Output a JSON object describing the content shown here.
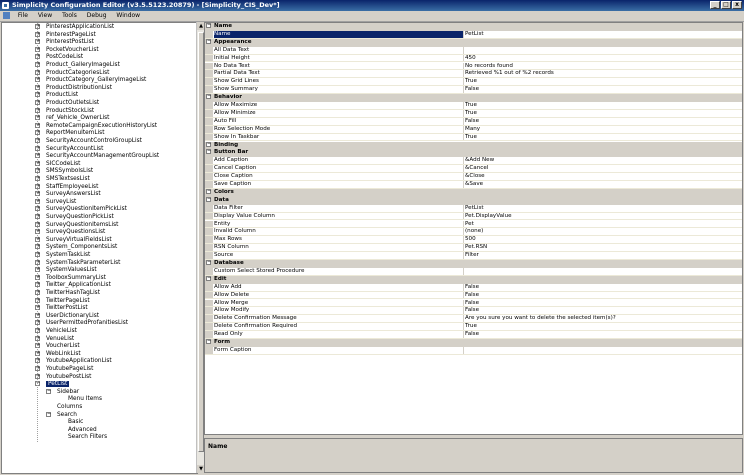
{
  "window": {
    "title": "Simplicity Configuration Editor (v3.5.5123.20879) - [Simplicity_CIS_Dev*]",
    "min": "_",
    "max": "□",
    "close": "x"
  },
  "menu": [
    "File",
    "View",
    "Tools",
    "Debug",
    "Window"
  ],
  "tree": {
    "collapsed_items": [
      "PinterestApplicationList",
      "PinterestPageList",
      "PinterestPostList",
      "PocketVoucherList",
      "PostCodeList",
      "Product_GalleryImageList",
      "ProductCategoriesList",
      "ProductCategory_GalleryImageList",
      "ProductDistributionList",
      "ProductList",
      "ProductOutletsList",
      "ProductStockList",
      "ref_Vehicle_OwnerList",
      "RemoteCampaignExecutionHistoryList",
      "ReportMenuItemList",
      "SecurityAccountControlGroupList",
      "SecurityAccountList",
      "SecurityAccountManagementGroupList",
      "SICCodeList",
      "SMSSymbolsList",
      "SMSTextsesList",
      "StaffEmployeeList",
      "SurveyAnswersList",
      "SurveyList",
      "SurveyQuestionItemPickList",
      "SurveyQuestionPickList",
      "SurveyQuestionItemsList",
      "SurveyQuestionsList",
      "SurveyVirtualFieldsList",
      "System_ComponentsList",
      "SystemTaskList",
      "SystemTaskParameterList",
      "SystemValuesList",
      "ToolboxSummaryList",
      "Twitter_ApplicationList",
      "TwitterHashTagList",
      "TwitterPageList",
      "TwitterPostList",
      "UserDictionaryList",
      "UserPermittedProfanitiesList",
      "VehicleList",
      "VenueList",
      "VoucherList",
      "WebLinkList",
      "YoutubeApplicationList",
      "YoutubePageList",
      "YoutubePostList"
    ],
    "expanded_item": "PetList",
    "children": [
      {
        "label": "Sidebar",
        "level": 1,
        "toggle": "−"
      },
      {
        "label": "Menu Items",
        "level": 2,
        "toggle": ""
      },
      {
        "label": "Columns",
        "level": 1,
        "toggle": ""
      },
      {
        "label": "Search",
        "level": 1,
        "toggle": "−"
      },
      {
        "label": "Basic",
        "level": 2,
        "toggle": ""
      },
      {
        "label": "Advanced",
        "level": 2,
        "toggle": ""
      },
      {
        "label": "Search Filters",
        "level": 2,
        "toggle": ""
      }
    ]
  },
  "properties": [
    {
      "type": "cat",
      "name": "Name"
    },
    {
      "type": "item",
      "name": "Name",
      "value": "PetList",
      "selected": true
    },
    {
      "type": "cat",
      "name": "Appearance"
    },
    {
      "type": "item",
      "name": "All Data Text",
      "value": ""
    },
    {
      "type": "item",
      "name": "Initial Height",
      "value": "450"
    },
    {
      "type": "item",
      "name": "No Data Text",
      "value": "No records found"
    },
    {
      "type": "item",
      "name": "Partial Data Text",
      "value": "Retrieved %1 out of %2 records"
    },
    {
      "type": "item",
      "name": "Show Grid Lines",
      "value": "True"
    },
    {
      "type": "item",
      "name": "Show Summary",
      "value": "False"
    },
    {
      "type": "cat",
      "name": "Behavior"
    },
    {
      "type": "item",
      "name": "Allow Maximize",
      "value": "True"
    },
    {
      "type": "item",
      "name": "Allow Minimize",
      "value": "True"
    },
    {
      "type": "item",
      "name": "Auto Fill",
      "value": "False"
    },
    {
      "type": "item",
      "name": "Row Selection Mode",
      "value": "Many"
    },
    {
      "type": "item",
      "name": "Show In Taskbar",
      "value": "True"
    },
    {
      "type": "cat",
      "name": "Binding"
    },
    {
      "type": "cat",
      "name": "Button Bar"
    },
    {
      "type": "item",
      "name": "Add Caption",
      "value": "&Add New"
    },
    {
      "type": "item",
      "name": "Cancel Caption",
      "value": "&Cancel"
    },
    {
      "type": "item",
      "name": "Close Caption",
      "value": "&Close"
    },
    {
      "type": "item",
      "name": "Save Caption",
      "value": "&Save"
    },
    {
      "type": "cat",
      "name": "Colors"
    },
    {
      "type": "cat",
      "name": "Data"
    },
    {
      "type": "item",
      "name": "Data Filter",
      "value": "PetList"
    },
    {
      "type": "item",
      "name": "Display Value Column",
      "value": "Pet.DisplayValue"
    },
    {
      "type": "item",
      "name": "Entity",
      "value": "Pet"
    },
    {
      "type": "item",
      "name": "Invalid Column",
      "value": "(none)"
    },
    {
      "type": "item",
      "name": "Max Rows",
      "value": "500"
    },
    {
      "type": "item",
      "name": "RSN Column",
      "value": "Pet.RSN"
    },
    {
      "type": "item",
      "name": "Source",
      "value": "Filter"
    },
    {
      "type": "cat",
      "name": "Database"
    },
    {
      "type": "item",
      "name": "Custom Select Stored Procedure",
      "value": ""
    },
    {
      "type": "cat",
      "name": "Edit"
    },
    {
      "type": "item",
      "name": "Allow Add",
      "value": "False"
    },
    {
      "type": "item",
      "name": "Allow Delete",
      "value": "False"
    },
    {
      "type": "item",
      "name": "Allow Merge",
      "value": "False"
    },
    {
      "type": "item",
      "name": "Allow Modify",
      "value": "False"
    },
    {
      "type": "item",
      "name": "Delete Confirmation Message",
      "value": "Are you sure you want to delete the selected item(s)?"
    },
    {
      "type": "item",
      "name": "Delete Confirmation Required",
      "value": "True"
    },
    {
      "type": "item",
      "name": "Read Only",
      "value": "False"
    },
    {
      "type": "cat",
      "name": "Form"
    },
    {
      "type": "item",
      "name": "Form Caption",
      "value": ""
    }
  ],
  "description": {
    "title": "Name"
  },
  "icons": {
    "app": "app-icon",
    "doc": "document-icon"
  }
}
